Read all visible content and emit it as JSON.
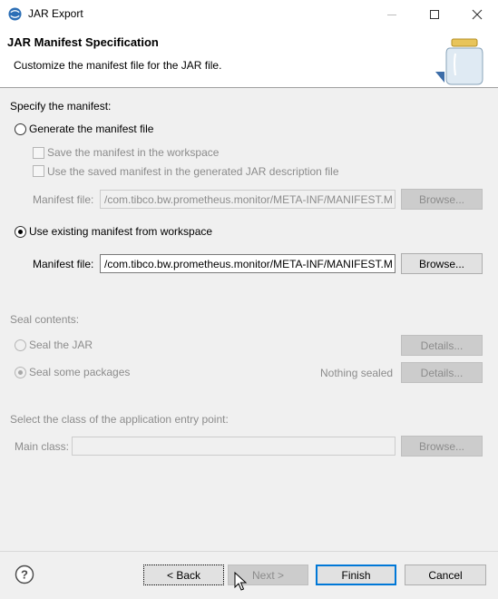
{
  "window": {
    "title": "JAR Export",
    "minimize_glyph": "—",
    "maximize_glyph": "☐",
    "close_glyph": "✕"
  },
  "header": {
    "title": "JAR Manifest Specification",
    "description": "Customize the manifest file for the JAR file."
  },
  "manifest": {
    "section_label": "Specify the manifest:",
    "generate_label": "Generate the manifest file",
    "save_label": "Save the manifest in the workspace",
    "use_saved_label": "Use the saved manifest in the generated JAR description file",
    "generated_file_label": "Manifest file:",
    "generated_file_value": "/com.tibco.bw.prometheus.monitor/META-INF/MANIFEST.M",
    "generated_browse": "Browse...",
    "use_existing_label": "Use existing manifest from workspace",
    "existing_file_label": "Manifest file:",
    "existing_file_value": "/com.tibco.bw.prometheus.monitor/META-INF/MANIFEST.M",
    "existing_browse": "Browse..."
  },
  "seal": {
    "section_label": "Seal contents:",
    "seal_jar_label": "Seal the JAR",
    "seal_jar_details": "Details...",
    "seal_packages_label": "Seal some packages",
    "nothing_sealed": "Nothing sealed",
    "seal_packages_details": "Details..."
  },
  "entry": {
    "section_label": "Select the class of the application entry point:",
    "main_class_label": "Main class:",
    "main_class_value": "",
    "browse": "Browse..."
  },
  "footer": {
    "help_glyph": "?",
    "back": "< Back",
    "next": "Next >",
    "finish": "Finish",
    "cancel": "Cancel"
  }
}
